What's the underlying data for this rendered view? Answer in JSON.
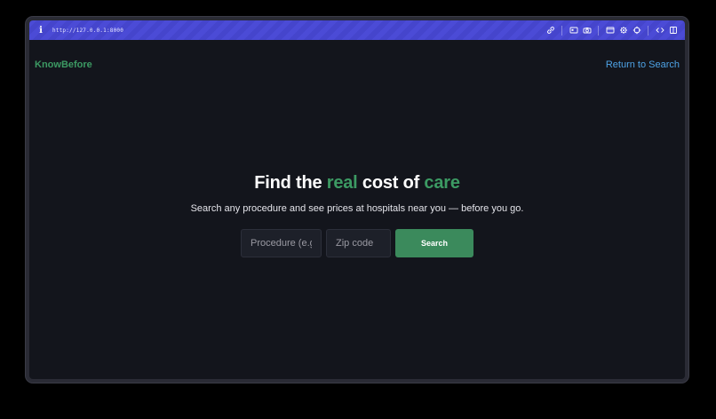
{
  "browser": {
    "url": "http://127.0.0.1:8000",
    "info_icon": "i",
    "toolbar_icons": [
      "link-icon",
      "id-card-icon",
      "camera-icon",
      "window-icon",
      "gear-icon",
      "crosshair-icon",
      "code-icon",
      "sidebar-icon"
    ]
  },
  "header": {
    "brand": "KnowBefore",
    "return_link": "Return to Search"
  },
  "hero": {
    "title_part1": "Find the ",
    "title_accent1": "real",
    "title_part2": " cost of ",
    "title_accent2": "care",
    "subtitle": "Search any procedure and see prices at hospitals near you — before you go."
  },
  "search": {
    "procedure_placeholder": "Procedure (e.g. MRI, knee replacement)",
    "zip_placeholder": "Zip code",
    "button_label": "Search"
  },
  "colors": {
    "accent_green": "#3c9a63",
    "link_blue": "#4ea3e6",
    "url_bar": "#4b4bd6",
    "page_bg": "#13151c"
  }
}
